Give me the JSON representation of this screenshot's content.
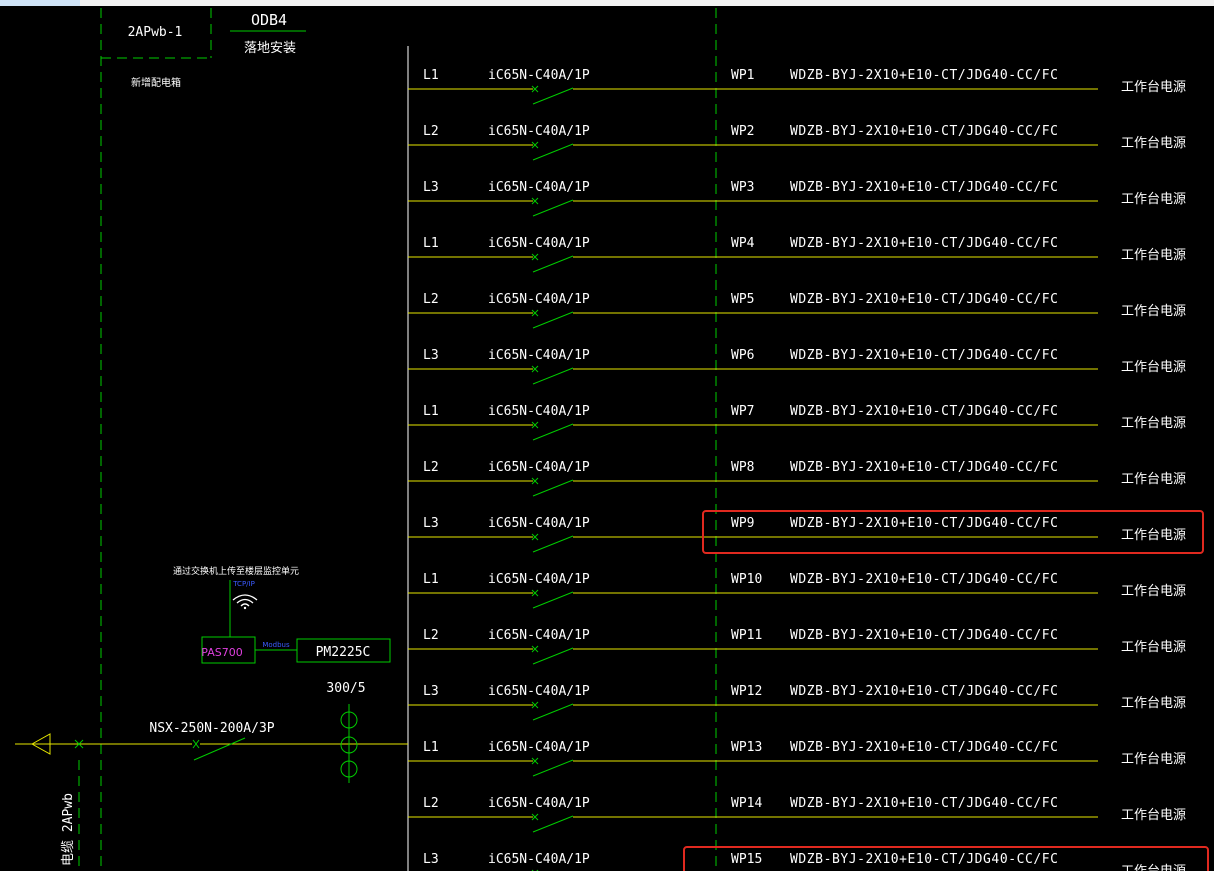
{
  "panel": {
    "id": "2APwb-1",
    "note": "新增配电箱",
    "name": "ODB4",
    "install": "落地安装"
  },
  "incoming": {
    "breaker": "NSX-250N-200A/3P",
    "ct_ratio": "300/5",
    "feeder": "2APwb",
    "feeder_prefix": "电缆"
  },
  "monitoring": {
    "note": "通过交换机上传至楼层监控单元",
    "tag": "TCP/IP",
    "device": "PAS700",
    "link": "Modbus",
    "meter": "PM2225C"
  },
  "circuits": [
    {
      "phase": "L1",
      "breaker": "iC65N-C40A/1P",
      "id": "WP1",
      "cable": "WDZB-BYJ-2X10+E10-CT/JDG40-CC/FC",
      "load": "工作台电源"
    },
    {
      "phase": "L2",
      "breaker": "iC65N-C40A/1P",
      "id": "WP2",
      "cable": "WDZB-BYJ-2X10+E10-CT/JDG40-CC/FC",
      "load": "工作台电源"
    },
    {
      "phase": "L3",
      "breaker": "iC65N-C40A/1P",
      "id": "WP3",
      "cable": "WDZB-BYJ-2X10+E10-CT/JDG40-CC/FC",
      "load": "工作台电源"
    },
    {
      "phase": "L1",
      "breaker": "iC65N-C40A/1P",
      "id": "WP4",
      "cable": "WDZB-BYJ-2X10+E10-CT/JDG40-CC/FC",
      "load": "工作台电源"
    },
    {
      "phase": "L2",
      "breaker": "iC65N-C40A/1P",
      "id": "WP5",
      "cable": "WDZB-BYJ-2X10+E10-CT/JDG40-CC/FC",
      "load": "工作台电源"
    },
    {
      "phase": "L3",
      "breaker": "iC65N-C40A/1P",
      "id": "WP6",
      "cable": "WDZB-BYJ-2X10+E10-CT/JDG40-CC/FC",
      "load": "工作台电源"
    },
    {
      "phase": "L1",
      "breaker": "iC65N-C40A/1P",
      "id": "WP7",
      "cable": "WDZB-BYJ-2X10+E10-CT/JDG40-CC/FC",
      "load": "工作台电源"
    },
    {
      "phase": "L2",
      "breaker": "iC65N-C40A/1P",
      "id": "WP8",
      "cable": "WDZB-BYJ-2X10+E10-CT/JDG40-CC/FC",
      "load": "工作台电源"
    },
    {
      "phase": "L3",
      "breaker": "iC65N-C40A/1P",
      "id": "WP9",
      "cable": "WDZB-BYJ-2X10+E10-CT/JDG40-CC/FC",
      "load": "工作台电源",
      "highlight": true
    },
    {
      "phase": "L1",
      "breaker": "iC65N-C40A/1P",
      "id": "WP10",
      "cable": "WDZB-BYJ-2X10+E10-CT/JDG40-CC/FC",
      "load": "工作台电源"
    },
    {
      "phase": "L2",
      "breaker": "iC65N-C40A/1P",
      "id": "WP11",
      "cable": "WDZB-BYJ-2X10+E10-CT/JDG40-CC/FC",
      "load": "工作台电源"
    },
    {
      "phase": "L3",
      "breaker": "iC65N-C40A/1P",
      "id": "WP12",
      "cable": "WDZB-BYJ-2X10+E10-CT/JDG40-CC/FC",
      "load": "工作台电源"
    },
    {
      "phase": "L1",
      "breaker": "iC65N-C40A/1P",
      "id": "WP13",
      "cable": "WDZB-BYJ-2X10+E10-CT/JDG40-CC/FC",
      "load": "工作台电源"
    },
    {
      "phase": "L2",
      "breaker": "iC65N-C40A/1P",
      "id": "WP14",
      "cable": "WDZB-BYJ-2X10+E10-CT/JDG40-CC/FC",
      "load": "工作台电源"
    },
    {
      "phase": "L3",
      "breaker": "iC65N-C40A/1P",
      "id": "WP15",
      "cable": "WDZB-BYJ-2X10+E10-CT/JDG40-CC/FC",
      "load": "工作台电源",
      "highlight": true
    }
  ],
  "colors": {
    "background": "#000000",
    "text": "#ffffff",
    "line": "#e6e600",
    "switch": "#00cc00",
    "dashed": "#00cc00",
    "highlight": "#e0291f",
    "device_text": "#e040e0",
    "link_text": "#3b5bff"
  }
}
